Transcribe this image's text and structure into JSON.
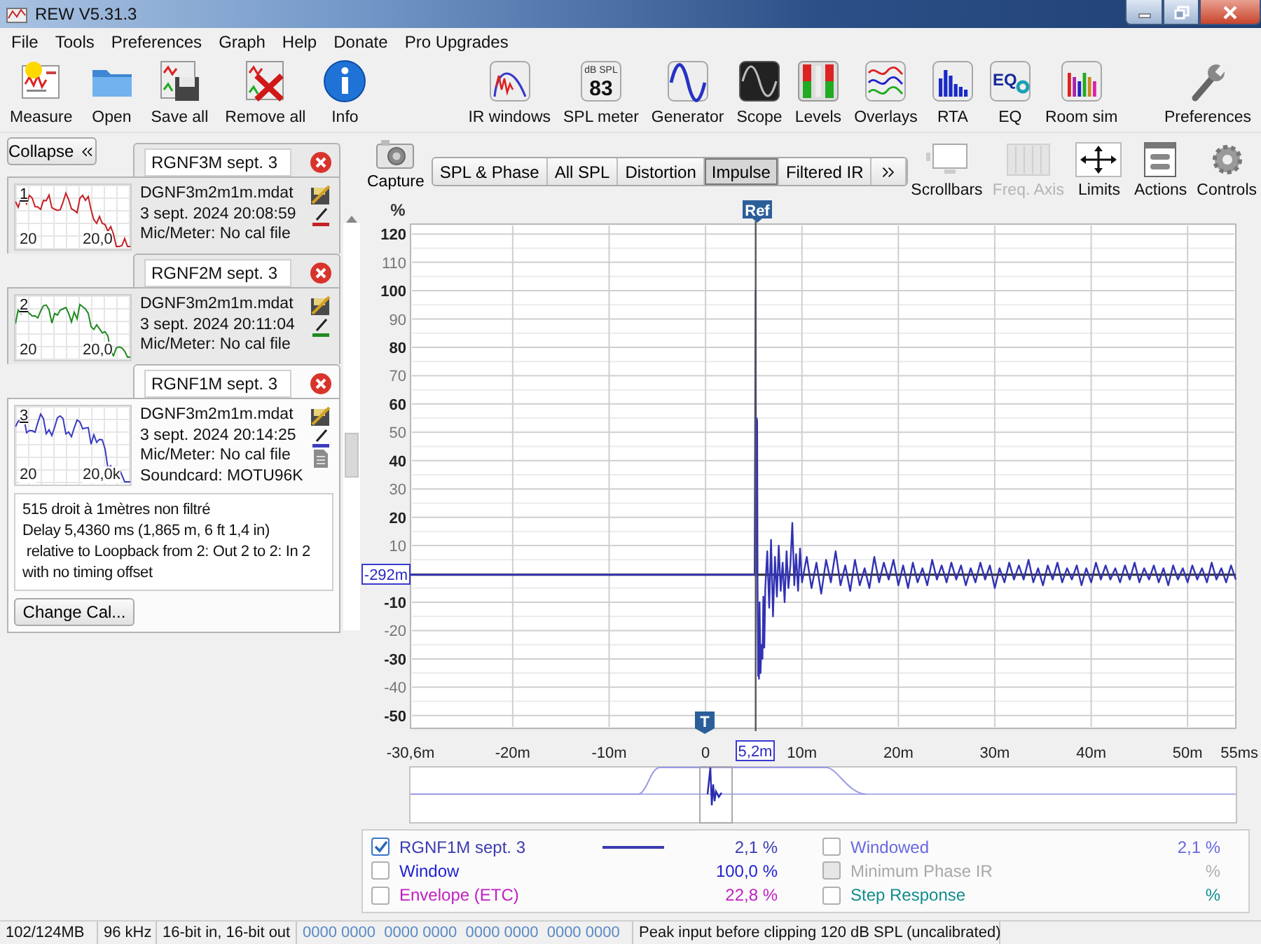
{
  "window": {
    "title": "REW V5.31.3"
  },
  "menu": [
    "File",
    "Tools",
    "Preferences",
    "Graph",
    "Help",
    "Donate",
    "Pro Upgrades"
  ],
  "toolbar_left": [
    {
      "label": "Measure",
      "kind": "measure"
    },
    {
      "label": "Open",
      "kind": "open"
    },
    {
      "label": "Save all",
      "kind": "saveall"
    },
    {
      "label": "Remove all",
      "kind": "removeall"
    },
    {
      "label": "Info",
      "kind": "info"
    }
  ],
  "toolbar_center": [
    {
      "label": "IR windows",
      "kind": "irwindows"
    },
    {
      "label": "SPL meter",
      "kind": "spl",
      "icon_texts": [
        "dB SPL",
        "83"
      ]
    },
    {
      "label": "Generator",
      "kind": "generator"
    },
    {
      "label": "Scope",
      "kind": "scope"
    },
    {
      "label": "Levels",
      "kind": "levels"
    },
    {
      "label": "Overlays",
      "kind": "overlays"
    },
    {
      "label": "RTA",
      "kind": "rta"
    },
    {
      "label": "EQ",
      "kind": "eq",
      "icon_texts": [
        "EQ"
      ]
    },
    {
      "label": "Room sim",
      "kind": "roomsim"
    }
  ],
  "toolbar_right": [
    {
      "label": "Preferences",
      "kind": "preferences"
    }
  ],
  "side_panel": {
    "collapse": "Collapse",
    "change_cal": "Change Cal..."
  },
  "measurements": [
    {
      "number": "1",
      "name": "RGNF3M sept. 3",
      "file": "DGNF3m2m1m.mdat",
      "date": "3 sept. 2024 20:08:59",
      "mic": "Mic/Meter: No cal file",
      "axis_low": "20",
      "axis_high": "20,0",
      "color": "#c42127",
      "selected": false
    },
    {
      "number": "2",
      "name": "RGNF2M sept. 3",
      "file": "DGNF3m2m1m.mdat",
      "date": "3 sept. 2024 20:11:04",
      "mic": "Mic/Meter: No cal file",
      "axis_low": "20",
      "axis_high": "20,0",
      "color": "#1f8a1f",
      "selected": false
    },
    {
      "number": "3",
      "name": "RGNF1M sept. 3",
      "file": "DGNF3m2m1m.mdat",
      "date": "3 sept. 2024 20:14:25",
      "mic": "Mic/Meter: No cal file",
      "soundcard": "Soundcard: MOTU96K",
      "axis_low": "20",
      "axis_high": "20,0k",
      "color": "#3b3bc0",
      "selected": true,
      "notes": [
        "515 droit à 1mètres non filtré",
        "Delay 5,4360 ms (1,865 m, 6 ft 1,4 in)",
        " relative to Loopback from 2: Out 2 to 2: In 2",
        "with no timing offset"
      ]
    }
  ],
  "capture": "Capture",
  "graph_tabs": [
    {
      "label": "SPL & Phase",
      "selected": false
    },
    {
      "label": "All SPL",
      "selected": false
    },
    {
      "label": "Distortion",
      "selected": false
    },
    {
      "label": "Impulse",
      "selected": true
    },
    {
      "label": "Filtered IR",
      "selected": false
    }
  ],
  "graph_tools": [
    {
      "label": "Scrollbars",
      "kind": "scrollbars",
      "disabled": false
    },
    {
      "label": "Freq. Axis",
      "kind": "freq",
      "disabled": true
    },
    {
      "label": "Limits",
      "kind": "limits",
      "disabled": false
    },
    {
      "label": "Actions",
      "kind": "actions",
      "disabled": false
    },
    {
      "label": "Controls",
      "kind": "controls",
      "disabled": false
    }
  ],
  "graph": {
    "ref_marker": "Ref",
    "time_marker": "T",
    "y_cursor": "-292m",
    "x_cursor": "5,2m",
    "chart_data": {
      "type": "line",
      "ylabel": "%",
      "xlim": [
        -30.6,
        55
      ],
      "ylim": [
        -54.5,
        123.5
      ],
      "grid": true,
      "ref_lines": [
        {
          "axis": "x",
          "value": 5.2
        },
        {
          "axis": "y",
          "value": -0.292
        }
      ],
      "yticks": [
        120,
        110,
        100,
        90,
        80,
        70,
        60,
        50,
        40,
        30,
        20,
        10,
        -10,
        -20,
        -30,
        -40,
        -50
      ],
      "xticks": [
        {
          "value": -30.6,
          "label": "-30,6m"
        },
        {
          "value": -20,
          "label": "-20m"
        },
        {
          "value": -10,
          "label": "-10m"
        },
        {
          "value": 0,
          "label": "0"
        },
        {
          "value": 10,
          "label": "10m"
        },
        {
          "value": 20,
          "label": "20m"
        },
        {
          "value": 30,
          "label": "30m"
        },
        {
          "value": 40,
          "label": "40m"
        },
        {
          "value": 50,
          "label": "50m"
        },
        {
          "value": 55,
          "label": "55ms"
        }
      ],
      "x": [
        -30.6,
        5.1,
        5.2,
        5.25,
        5.3,
        5.35,
        5.4,
        5.45,
        5.5,
        5.55,
        5.6,
        5.7,
        5.8,
        5.9,
        6.0,
        6.1,
        6.2,
        6.4,
        6.6,
        6.8,
        7.0,
        7.2,
        7.4,
        7.6,
        7.8,
        8.0,
        8.2,
        8.4,
        8.6,
        8.8,
        9.0,
        9.2,
        9.4,
        9.6,
        9.8,
        10.0,
        10.5,
        11,
        11.5,
        12,
        12.5,
        13,
        13.5,
        14,
        14.5,
        15,
        15.5,
        16,
        16.5,
        17,
        17.5,
        18,
        18.5,
        19,
        19.5,
        20,
        20.5,
        21,
        21.5,
        22,
        22.5,
        23,
        23.5,
        24,
        24.5,
        25,
        25.5,
        26,
        26.5,
        27,
        27.5,
        28,
        28.5,
        29,
        29.5,
        30,
        30.5,
        31,
        31.5,
        32,
        32.5,
        33,
        33.5,
        34,
        34.5,
        35,
        35.5,
        36,
        36.5,
        37,
        37.5,
        38,
        38.5,
        39,
        39.5,
        40,
        40.5,
        41,
        41.5,
        42,
        42.5,
        43,
        43.5,
        44,
        44.5,
        45,
        45.5,
        46,
        46.5,
        47,
        47.5,
        48,
        48.5,
        49,
        49.5,
        50,
        50.5,
        51,
        51.5,
        52,
        52.5,
        53,
        53.5,
        54,
        54.5,
        55
      ],
      "series": [
        {
          "color": "#3232b4",
          "values": [
            -0.3,
            -0.3,
            100,
            0,
            55,
            54,
            -5,
            -36,
            -20,
            -37,
            -10,
            -35,
            -25,
            -30,
            -8,
            -26,
            -5,
            8,
            -12,
            12,
            -15,
            6,
            -8,
            10,
            -6,
            4,
            -10,
            8,
            -5,
            3,
            18,
            -4,
            7,
            -6,
            9,
            -3,
            6,
            -5,
            4,
            -7,
            5,
            -3,
            8,
            -4,
            3,
            -6,
            5,
            -4,
            2,
            -5,
            6,
            -3,
            4,
            -2,
            5,
            -4,
            3,
            -5,
            4,
            -3,
            2,
            -4,
            5,
            -2,
            3,
            -3,
            4,
            -2,
            3,
            -4,
            2,
            -3,
            4,
            -2,
            3,
            -5,
            2,
            -3,
            4,
            -2,
            3,
            -2,
            5,
            -3,
            2,
            -4,
            3,
            -2,
            4,
            -3,
            2,
            -2,
            3,
            -4,
            2,
            -3,
            4,
            -2,
            3,
            -2,
            2,
            -3,
            3,
            -2,
            4,
            -3,
            2,
            -2,
            3,
            -3,
            2,
            -4,
            3,
            -2,
            2,
            -3,
            3,
            -2,
            2,
            -3,
            4,
            -2,
            2,
            -3,
            3,
            -2
          ]
        }
      ]
    }
  },
  "legend": [
    {
      "label": "RGNF1M sept. 3",
      "value": "2,1 %",
      "checked": true,
      "disabled": false,
      "color": "#3b3bb0",
      "swatch": true
    },
    {
      "label": "Window",
      "value": "100,0 %",
      "checked": false,
      "disabled": false,
      "color": "#2020d0"
    },
    {
      "label": "Envelope (ETC)",
      "value": "22,8 %",
      "checked": false,
      "disabled": false,
      "color": "#c020c0"
    },
    {
      "label": "Windowed",
      "value": "2,1 %",
      "checked": false,
      "disabled": false,
      "color": "#6868e0"
    },
    {
      "label": "Minimum Phase IR",
      "value": "%",
      "checked": false,
      "disabled": true,
      "color": "#a8a8a8"
    },
    {
      "label": "Step Response",
      "value": "%",
      "checked": false,
      "disabled": false,
      "color": "#128c8c"
    }
  ],
  "status_bar": [
    {
      "text": "102/124MB",
      "kind": "plain"
    },
    {
      "text": "96 kHz",
      "kind": "plain"
    },
    {
      "text": "16-bit in, 16-bit out",
      "kind": "plain"
    },
    {
      "text": "0000 0000  0000 0000  0000 0000  0000 0000",
      "kind": "bits"
    },
    {
      "text": "Peak input before clipping 120 dB SPL (uncalibrated)",
      "kind": "plain"
    }
  ]
}
